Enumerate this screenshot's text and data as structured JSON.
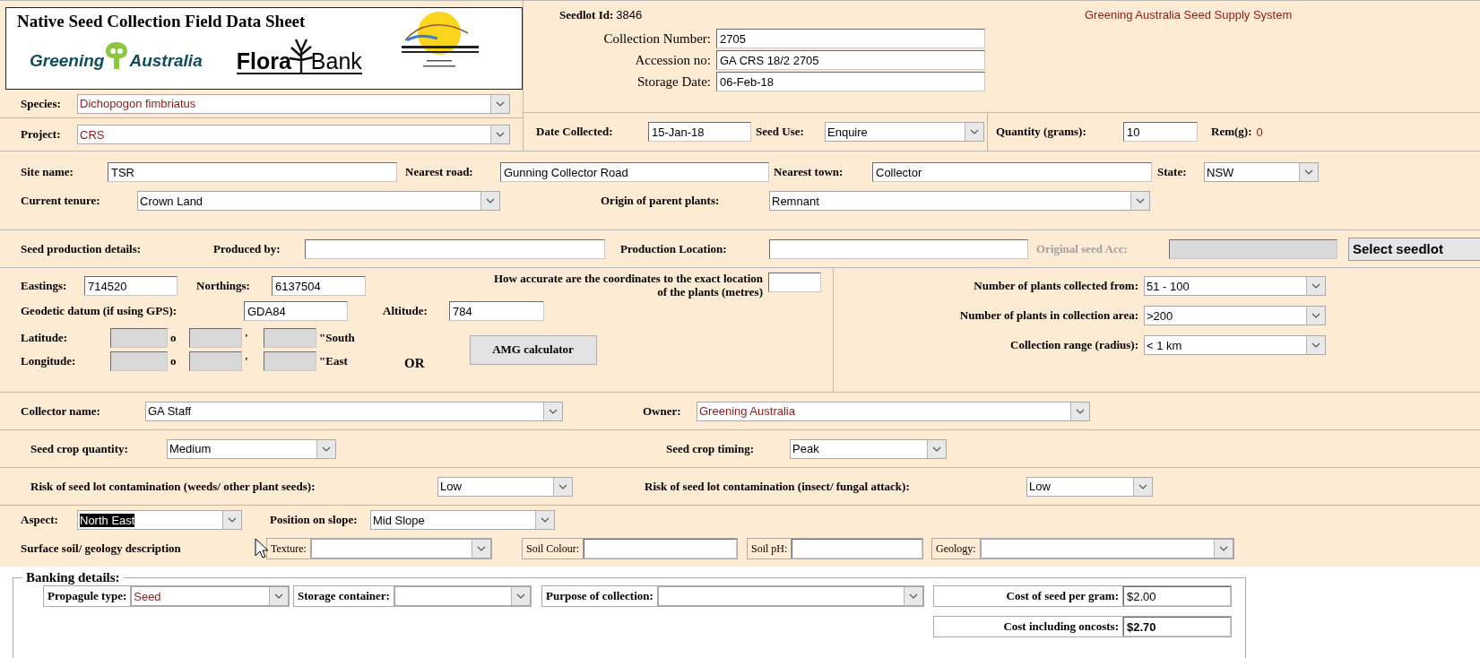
{
  "header": {
    "title": "Native Seed Collection Field Data Sheet",
    "logos": [
      {
        "kind": "tree",
        "parts": [
          "Greening",
          "Australia"
        ]
      },
      {
        "kind": "plant",
        "parts": [
          "Flora",
          "Bank"
        ]
      },
      {
        "kind": "emblem"
      }
    ]
  },
  "record": {
    "seedlot_label": "Seedlot Id:",
    "seedlot_id": "3846",
    "system_name": "Greening Australia Seed Supply System",
    "fields": [
      {
        "label": "Collection Number:",
        "kind": "text",
        "value": "2705"
      },
      {
        "label": "Accession no:",
        "kind": "text",
        "value": "GA CRS 18/2 2705"
      },
      {
        "label": "Storage Date:",
        "kind": "text",
        "value": "06-Feb-18"
      }
    ]
  },
  "species": {
    "label": "Species:",
    "kind": "dropdown",
    "value": "Dichopogon fimbriatus",
    "color": "#8b1a1a"
  },
  "project": {
    "label": "Project:",
    "kind": "dropdown",
    "value": "CRS",
    "color": "#8b1a1a"
  },
  "collection": [
    {
      "label": "Date Collected:",
      "kind": "text",
      "value": "15-Jan-18"
    },
    {
      "label": "Seed Use:",
      "kind": "dropdown",
      "value": "Enquire"
    }
  ],
  "quantity": {
    "label": "Quantity (grams):",
    "kind": "text",
    "value": "10"
  },
  "remaining": {
    "label": "Rem(g):",
    "value": "0",
    "color": "#8b1a1a"
  },
  "site": [
    [
      {
        "label": "Site name:",
        "kind": "text",
        "value": "TSR"
      },
      {
        "label": "Nearest road:",
        "kind": "text",
        "value": "Gunning Collector Road"
      },
      {
        "label": "Nearest town:",
        "kind": "text",
        "value": "Collector"
      },
      {
        "label": "State:",
        "kind": "dropdown",
        "value": "NSW"
      }
    ],
    [
      {
        "label": "Current tenure:",
        "kind": "dropdown",
        "value": "Crown Land"
      },
      {
        "label": "Origin of parent plants:",
        "kind": "dropdown",
        "value": "Remnant"
      }
    ]
  ],
  "production": {
    "heading": "Seed production details:",
    "fields": [
      {
        "label": "Produced by:",
        "kind": "text",
        "disabled": false
      },
      {
        "label": "Production Location:",
        "kind": "text",
        "disabled": false
      },
      {
        "label": "Original seed Acc:",
        "kind": "text",
        "disabled": true
      }
    ],
    "button": "Select seedlot"
  },
  "coordinates": {
    "grid": [
      [
        {
          "label": "Eastings:",
          "kind": "text",
          "value": "714520"
        },
        {
          "label": "Northings:",
          "kind": "text",
          "value": "6137504"
        },
        {
          "label": "How accurate are the coordinates to the exact location of the plants (metres)",
          "kind": "text"
        }
      ],
      [
        {
          "label": "Geodetic datum (if using GPS):",
          "kind": "text",
          "value": "GDA84"
        },
        {
          "label": "Altitude:",
          "kind": "text",
          "value": "784"
        }
      ]
    ],
    "latlong": [
      {
        "label": "Latitude:",
        "units": [
          "o",
          "'",
          "\"South"
        ],
        "disabled": true
      },
      {
        "label": "Longitude:",
        "units": [
          "o",
          "'",
          "\"East"
        ],
        "disabled": true
      }
    ],
    "or": "OR",
    "button": "AMG calculator"
  },
  "plants": [
    {
      "label": "Number of plants collected from:",
      "kind": "dropdown",
      "value": "51 - 100"
    },
    {
      "label": "Number of plants in collection area:",
      "kind": "dropdown",
      "value": ">200"
    },
    {
      "label": "Collection range (radius):",
      "kind": "dropdown",
      "value": "< 1 km"
    }
  ],
  "collector": [
    {
      "label": "Collector name:",
      "kind": "dropdown",
      "value": "GA Staff"
    },
    {
      "label": "Owner:",
      "kind": "dropdown",
      "value": "Greening Australia",
      "color": "#8b1a1a"
    }
  ],
  "crop": [
    {
      "label": "Seed crop quantity:",
      "kind": "dropdown",
      "value": "Medium"
    },
    {
      "label": "Seed crop timing:",
      "kind": "dropdown",
      "value": "Peak"
    }
  ],
  "risk": [
    {
      "label": "Risk of seed lot contamination (weeds/ other plant seeds):",
      "kind": "dropdown",
      "value": "Low"
    },
    {
      "label": "Risk of seed lot contamination (insect/ fungal attack):",
      "kind": "dropdown",
      "value": "Low"
    }
  ],
  "terrain": [
    {
      "label": "Aspect:",
      "kind": "dropdown",
      "value": "North East",
      "highlighted": true
    },
    {
      "label": "Position on slope:",
      "kind": "dropdown",
      "value": "Mid Slope",
      "highlighted": false
    }
  ],
  "soil": {
    "heading": "Surface soil/ geology description",
    "fields": [
      {
        "label": "Texture:",
        "kind": "dropdown"
      },
      {
        "label": "Soil Colour:",
        "kind": "text"
      },
      {
        "label": "Soil pH:",
        "kind": "text"
      },
      {
        "label": "Geology:",
        "kind": "dropdown"
      }
    ]
  },
  "banking": {
    "heading": "Banking details:",
    "fields": [
      {
        "label": "Propagule type:",
        "kind": "dropdown",
        "value": "Seed",
        "color": "#8b1a1a",
        "bold": false
      },
      {
        "label": "Storage container:",
        "kind": "dropdown"
      },
      {
        "label": "Purpose of collection:",
        "kind": "dropdown"
      },
      {
        "label": "Cost of seed per gram:",
        "kind": "text",
        "value": "$2.00",
        "bold": false
      },
      {
        "label": "Cost including oncosts:",
        "kind": "text",
        "value": "$2.70",
        "bold": true
      }
    ]
  }
}
